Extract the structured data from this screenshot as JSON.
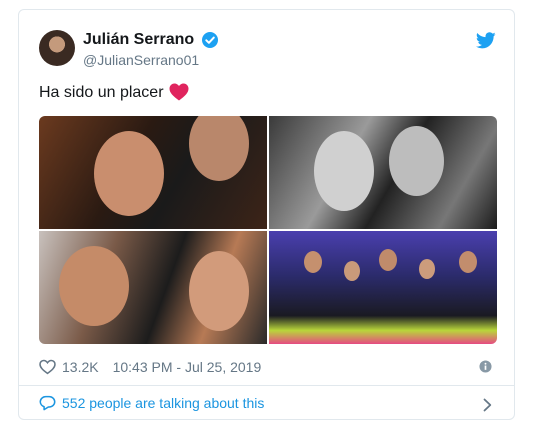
{
  "author": {
    "name": "Julián Serrano",
    "handle": "@JulianSerrano01",
    "verified": true
  },
  "tweet": {
    "text": "Ha sido un placer",
    "emoji": "heart-emoji"
  },
  "media": {
    "photo_count": 4
  },
  "stats": {
    "likes": "13.2K",
    "timestamp": "10:43 PM - Jul 25, 2019"
  },
  "conversation": {
    "label": "552 people are talking about this"
  },
  "colors": {
    "brand": "#1da1f2",
    "link": "#1b95e0",
    "heart": "#e0245e",
    "text": "#14171a",
    "muted": "#657786",
    "border": "#e1e8ed"
  },
  "icons": [
    "twitter-bird-icon",
    "verified-badge-icon",
    "heart-outline-icon",
    "info-icon",
    "speech-bubble-icon",
    "chevron-right-icon"
  ]
}
